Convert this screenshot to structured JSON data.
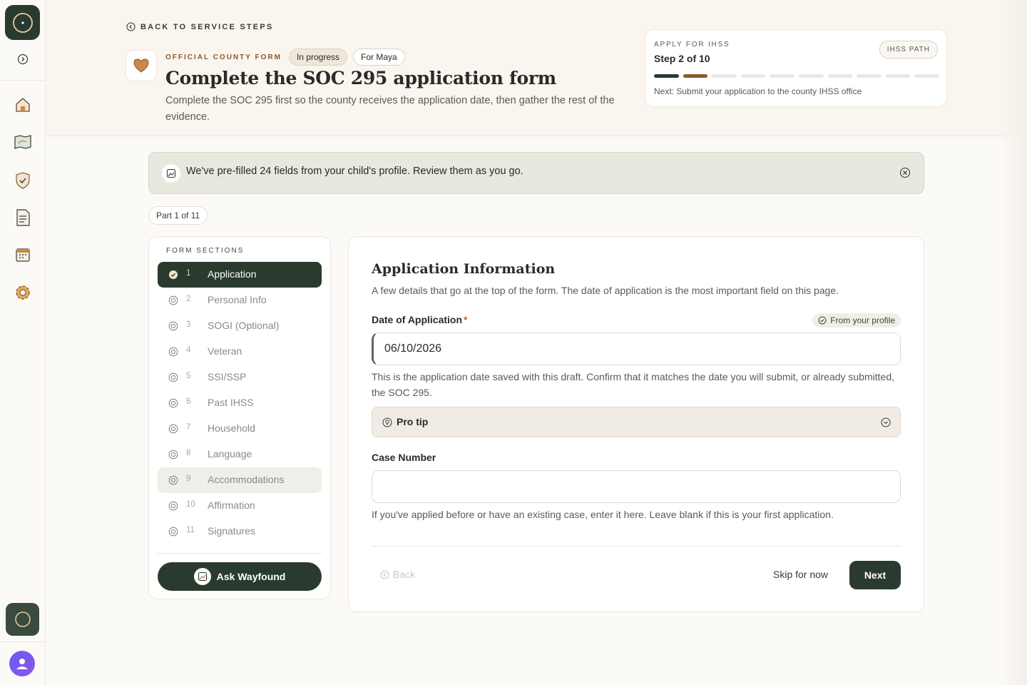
{
  "sidebar": {
    "icons": [
      "compass-logo-icon",
      "collapse-arrow-icon",
      "home-icon",
      "map-icon",
      "shield-icon",
      "document-icon",
      "calendar-icon",
      "gear-icon",
      "assistant-compass-icon",
      "user-avatar-icon"
    ]
  },
  "header": {
    "back_label": "BACK TO SERVICE STEPS",
    "kicker": "OFFICIAL COUNTY FORM",
    "status_pill": "In progress",
    "for_pill": "For Maya",
    "title": "Complete the SOC 295 application form",
    "subtitle": "Complete the SOC 295 first so the county receives the application date, then gather the rest of the evidence."
  },
  "step_card": {
    "kicker": "APPLY FOR IHSS",
    "title": "Step 2 of 10",
    "path_pill": "IHSS PATH",
    "total_steps": 10,
    "current_step": 2,
    "next_text": "Next: Submit your application to the county IHSS office"
  },
  "banner": {
    "text": "We've pre-filled 24 fields from your child's profile. Review them as you go."
  },
  "part_pill": "Part 1 of 11",
  "sections": {
    "title": "FORM SECTIONS",
    "items": [
      {
        "num": "1",
        "label": "Application"
      },
      {
        "num": "2",
        "label": "Personal Info"
      },
      {
        "num": "3",
        "label": "SOGI (Optional)"
      },
      {
        "num": "4",
        "label": "Veteran"
      },
      {
        "num": "5",
        "label": "SSI/SSP"
      },
      {
        "num": "6",
        "label": "Past IHSS"
      },
      {
        "num": "7",
        "label": "Household"
      },
      {
        "num": "8",
        "label": "Language"
      },
      {
        "num": "9",
        "label": "Accommodations"
      },
      {
        "num": "10",
        "label": "Affirmation"
      },
      {
        "num": "11",
        "label": "Signatures"
      }
    ],
    "ask_label": "Ask Wayfound"
  },
  "form": {
    "title": "Application Information",
    "subtitle": "A few details that go at the top of the form. The date of application is the most important field on this page.",
    "date_label": "Date of Application",
    "required_mark": "*",
    "profile_pill": "From your profile",
    "date_value": "06/10/2026",
    "date_helper": "This is the application date saved with this draft. Confirm that it matches the date you will submit, or already submitted, the SOC 295.",
    "protip_label": "Pro tip",
    "case_label": "Case Number",
    "case_value": "",
    "case_helper": "If you've applied before or have an existing case, enter it here. Leave blank if this is your first application.",
    "back_label": "Back",
    "skip_label": "Skip for now",
    "next_label": "Next"
  },
  "colors": {
    "primary_dark": "#2a3a2e",
    "accent_brown": "#8a5a30",
    "required": "#c06a2a"
  }
}
